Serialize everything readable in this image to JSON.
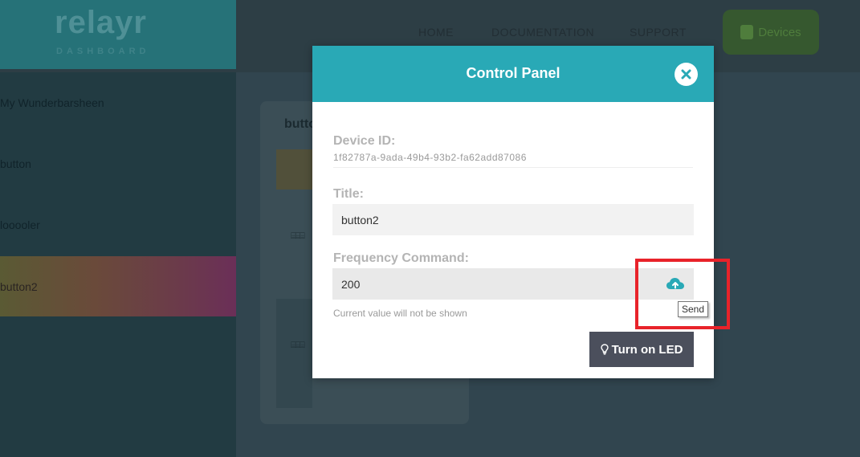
{
  "app": {
    "logo": "relayr",
    "logo_sub": "DASHBOARD",
    "nav": {
      "home": "HOME",
      "documentation": "DOCUMENTATION",
      "support": "SUPPORT",
      "devices": "Devices"
    },
    "sidebar": {
      "items": [
        {
          "label": "My Wunderbarsheen"
        },
        {
          "label": "button"
        },
        {
          "label": "looooler"
        },
        {
          "label": "button2"
        }
      ]
    },
    "card": {
      "title": "butto"
    }
  },
  "modal": {
    "title": "Control Panel",
    "device_id_label": "Device ID:",
    "device_id": "1f82787a-9ada-49b4-93b2-fa62add87086",
    "title_label": "Title:",
    "title_value": "button2",
    "frequency_label": "Frequency Command:",
    "frequency_value": "200",
    "hint": "Current value will not be shown",
    "send_tooltip": "Send",
    "led_button": "Turn on LED"
  },
  "colors": {
    "header": "#29a9b6",
    "button_dark": "#4b4f5c",
    "highlight": "#e8232a"
  },
  "icons": {
    "close": "close-icon",
    "send": "cloud-upload-icon",
    "led": "lightbulb-icon",
    "devices": "chip-icon"
  }
}
